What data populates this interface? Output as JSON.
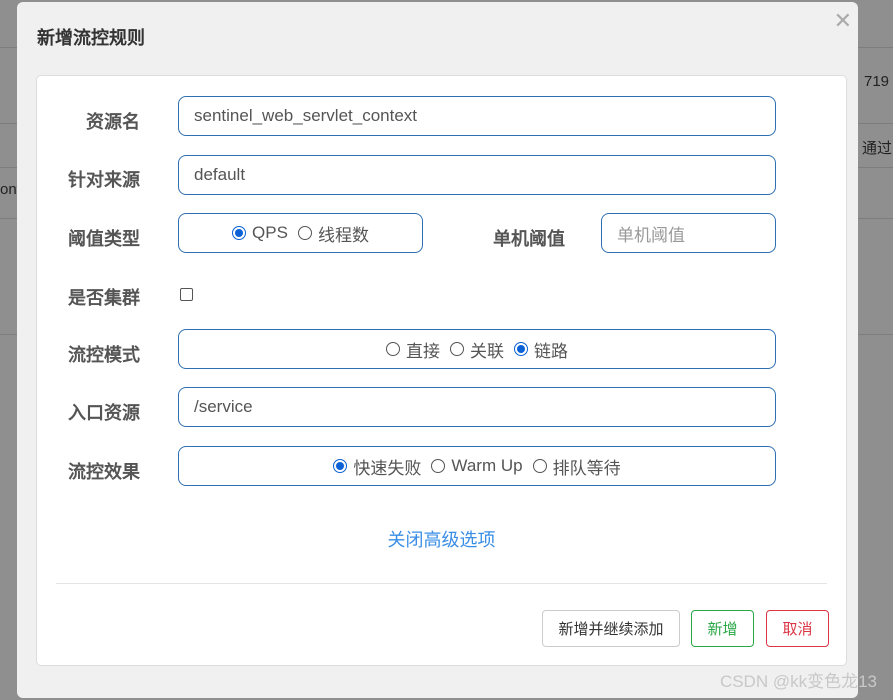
{
  "background": {
    "fragment_1": "719",
    "fragment_2": "通过",
    "fragment_3": "ont"
  },
  "dialog": {
    "title": "新增流控规则",
    "close_icon": "close-icon",
    "fields": {
      "resource_label": "资源名",
      "resource_value": "sentinel_web_servlet_context",
      "origin_label": "针对来源",
      "origin_value": "default",
      "threshold_type_label": "阈值类型",
      "threshold_type_options": [
        "QPS",
        "线程数"
      ],
      "threshold_type_selected": "QPS",
      "single_threshold_label": "单机阈值",
      "single_threshold_placeholder": "单机阈值",
      "cluster_label": "是否集群",
      "cluster_checked": false,
      "mode_label": "流控模式",
      "mode_options": [
        "直接",
        "关联",
        "链路"
      ],
      "mode_selected": "链路",
      "entry_label": "入口资源",
      "entry_value": "/service",
      "effect_label": "流控效果",
      "effect_options": [
        "快速失败",
        "Warm Up",
        "排队等待"
      ],
      "effect_selected": "快速失败"
    },
    "advanced_link": "关闭高级选项",
    "buttons": {
      "add_continue": "新增并继续添加",
      "add": "新增",
      "cancel": "取消"
    },
    "colors": {
      "add": "#28a745",
      "cancel": "#dc3545",
      "link": "#3a8ee6",
      "focus_border": "#2f6fb3"
    }
  },
  "watermark": "CSDN @kk变色龙13"
}
